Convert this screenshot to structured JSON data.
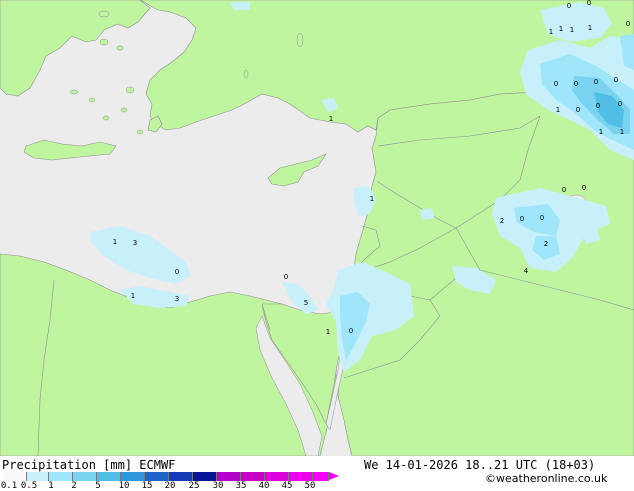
{
  "map": {
    "colors": {
      "sea": "#ececec",
      "land": "#c0f5a0",
      "border": "#8f8f8f",
      "coast": "#8f8f8f"
    },
    "precip_labels": [
      "0",
      "0",
      "0",
      "1",
      "1",
      "1",
      "1",
      "0",
      "0",
      "0",
      "0",
      "1",
      "0",
      "0",
      "0",
      "1",
      "1",
      "1",
      "1",
      "0",
      "0",
      "2",
      "0",
      "0",
      "2",
      "4",
      "1",
      "3",
      "0",
      "1",
      "3",
      "0",
      "5",
      "1",
      "0"
    ]
  },
  "footer": {
    "title": "Precipitation [mm]  ECMWF",
    "datetime": "We 14-01-2026 18..21 UTC (18+03)",
    "credit": "©weatheronline.co.uk",
    "scale_labels": [
      "0.1",
      "0.5",
      "1",
      "2",
      "5",
      "10",
      "15",
      "20",
      "25",
      "30",
      "35",
      "40",
      "45",
      "50"
    ],
    "scale_colors": [
      "#fafafa",
      "#c8f0fa",
      "#a0e6fa",
      "#78d2f0",
      "#50bee6",
      "#2d96dc",
      "#1e64c8",
      "#143cb4",
      "#0a1496",
      "#b400c8",
      "#c800c8",
      "#dc00dc",
      "#ee00ee",
      "#f800f8"
    ]
  }
}
